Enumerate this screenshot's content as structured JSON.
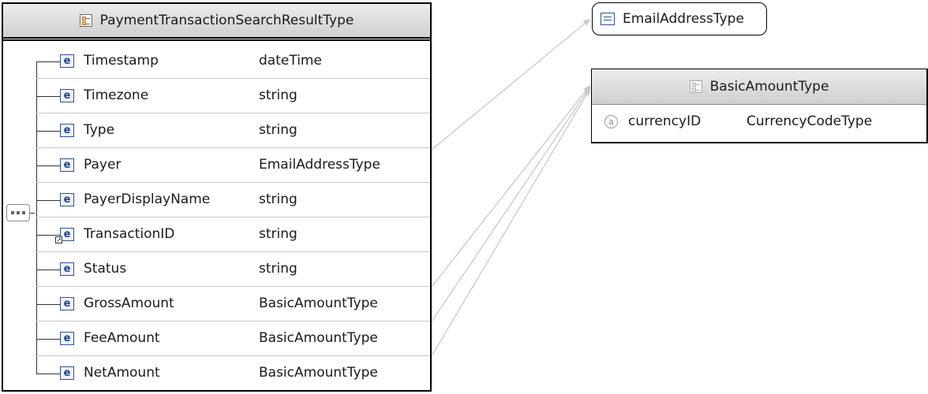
{
  "main_type": {
    "title": "PaymentTransactionSearchResultType",
    "elements": [
      {
        "name": "Timestamp",
        "type": "dateTime"
      },
      {
        "name": "Timezone",
        "type": "string"
      },
      {
        "name": "Type",
        "type": "string"
      },
      {
        "name": "Payer",
        "type": "EmailAddressType"
      },
      {
        "name": "PayerDisplayName",
        "type": "string"
      },
      {
        "name": "TransactionID",
        "type": "string",
        "reference": true
      },
      {
        "name": "Status",
        "type": "string"
      },
      {
        "name": "GrossAmount",
        "type": "BasicAmountType"
      },
      {
        "name": "FeeAmount",
        "type": "BasicAmountType"
      },
      {
        "name": "NetAmount",
        "type": "BasicAmountType"
      }
    ]
  },
  "email_type": {
    "title": "EmailAddressType"
  },
  "amount_type": {
    "title": "BasicAmountType",
    "attributes": [
      {
        "icon": "a",
        "name": "currencyID",
        "type": "CurrencyCodeType"
      }
    ]
  },
  "icons": {
    "element": "e",
    "complex_type": "complex-type-icon",
    "simple_type": "simple-type-icon",
    "sequence": "sequence-compositor-icon",
    "reference": "reference-arrow-icon"
  },
  "colors": {
    "element_icon": "#1e3f85",
    "header": "#d9d9d9",
    "link_line": "#b8b8b8"
  }
}
